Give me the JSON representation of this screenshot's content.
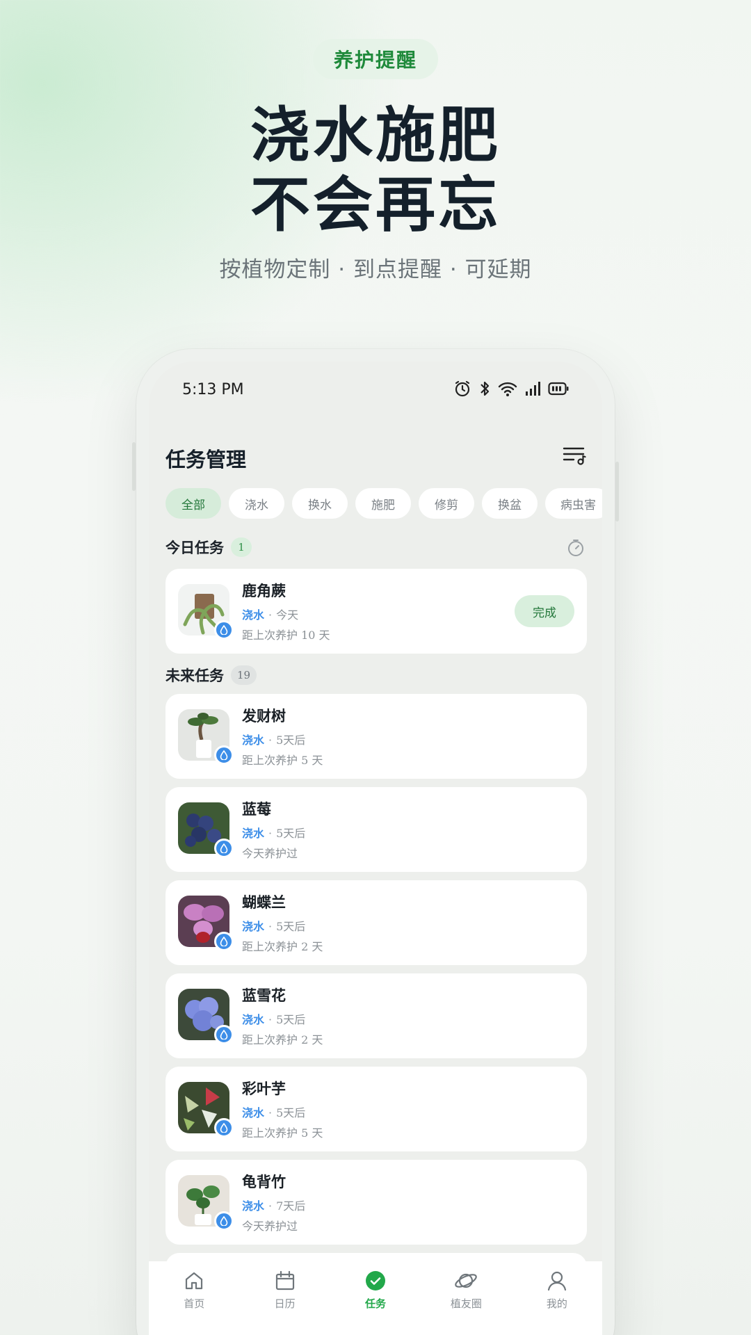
{
  "promo": {
    "badge": "养护提醒",
    "headline_1": "浇水施肥",
    "headline_2": "不会再忘",
    "subline": "按植物定制 · 到点提醒 · 可延期"
  },
  "status_bar": {
    "time": "5:13 PM"
  },
  "page": {
    "title": "任务管理"
  },
  "filters": [
    "全部",
    "浇水",
    "换水",
    "施肥",
    "修剪",
    "换盆",
    "病虫害"
  ],
  "today": {
    "title": "今日任务",
    "count": "1",
    "tasks": [
      {
        "name": "鹿角蕨",
        "type": "浇水",
        "when": "今天",
        "note": "距上次养护 10 天",
        "action": "完成"
      }
    ]
  },
  "future": {
    "title": "未来任务",
    "count": "19",
    "tasks": [
      {
        "name": "发财树",
        "type": "浇水",
        "when": "5天后",
        "note": "距上次养护 5 天"
      },
      {
        "name": "蓝莓",
        "type": "浇水",
        "when": "5天后",
        "note": "今天养护过"
      },
      {
        "name": "蝴蝶兰",
        "type": "浇水",
        "when": "5天后",
        "note": "距上次养护 2 天"
      },
      {
        "name": "蓝雪花",
        "type": "浇水",
        "when": "5天后",
        "note": "距上次养护 2 天"
      },
      {
        "name": "彩叶芋",
        "type": "浇水",
        "when": "5天后",
        "note": "距上次养护 5 天"
      },
      {
        "name": "龟背竹",
        "type": "浇水",
        "when": "7天后",
        "note": "今天养护过"
      }
    ]
  },
  "tabs": [
    {
      "label": "首页",
      "icon": "home-icon"
    },
    {
      "label": "日历",
      "icon": "calendar-icon"
    },
    {
      "label": "任务",
      "icon": "task-check-icon"
    },
    {
      "label": "植友圈",
      "icon": "planet-icon"
    },
    {
      "label": "我的",
      "icon": "profile-icon"
    }
  ],
  "colors": {
    "accent_green": "#22a84a",
    "water_blue": "#3d8ee8"
  }
}
